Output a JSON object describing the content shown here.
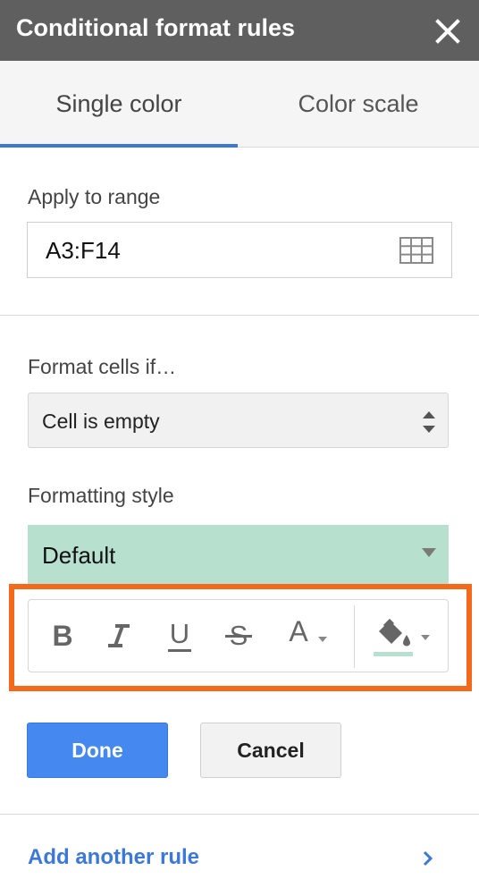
{
  "panel": {
    "title": "Conditional format rules",
    "close_icon": "close-icon"
  },
  "tabs": [
    {
      "label": "Single color",
      "active": true
    },
    {
      "label": "Color scale",
      "active": false
    }
  ],
  "apply_range": {
    "label": "Apply to range",
    "value": "A3:F14",
    "icon": "grid-icon"
  },
  "format_cells": {
    "label": "Format cells if…",
    "selected": "Cell is empty"
  },
  "formatting_style": {
    "label": "Formatting style",
    "selected": "Default",
    "fill_color": "#b8e0cf"
  },
  "toolbar": {
    "bold": "B",
    "italic_icon": "italic-icon",
    "underline": "U",
    "strikethrough": "S",
    "text_color": "A",
    "fill_icon": "paint-bucket-icon"
  },
  "actions": {
    "done_label": "Done",
    "cancel_label": "Cancel"
  },
  "footer": {
    "add_rule_label": "Add another rule"
  },
  "colors": {
    "titlebar": "#5f5f5f",
    "accent": "#3d78d8",
    "highlight": "#f56a1a",
    "done_button": "#4488f0"
  }
}
